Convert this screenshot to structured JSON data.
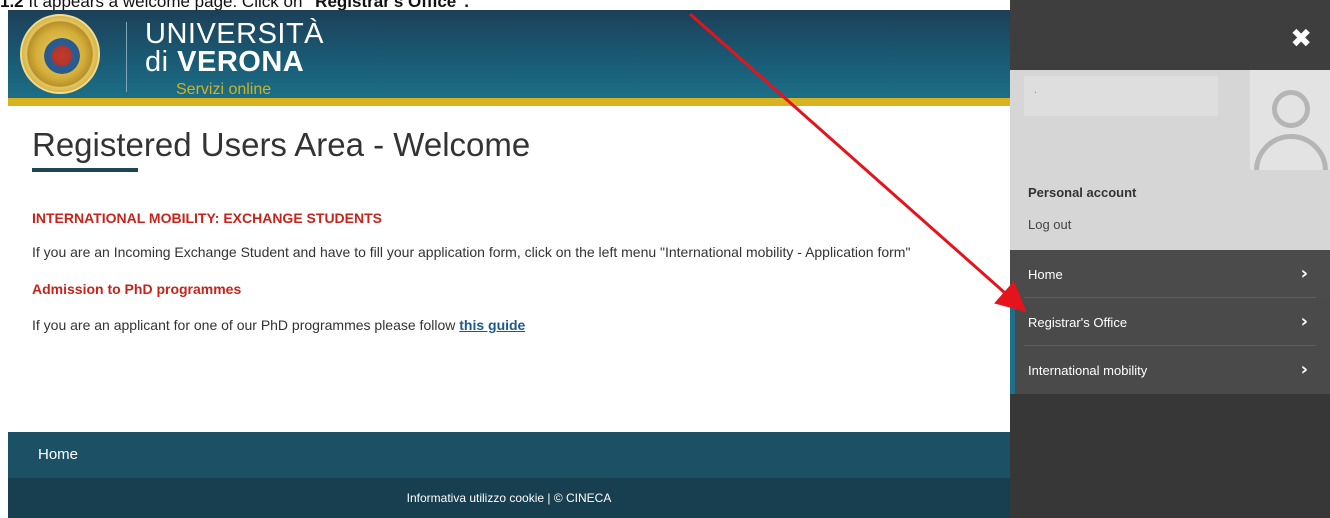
{
  "caption": {
    "prefix": "1.2 ",
    "text": "It appears a welcome page. Click on ",
    "bold": "\"Registrar's Office\"."
  },
  "header": {
    "logo_line1": "UNIVERSITÀ",
    "logo_line2_prefix": "di ",
    "logo_line2_bold": "VERONA",
    "logo_sub": "Servizi online"
  },
  "main": {
    "title": "Registered Users Area - Welcome",
    "section1_heading": "INTERNATIONAL MOBILITY: EXCHANGE STUDENTS",
    "section1_text": "If you are an Incoming Exchange Student and have to fill your application form, click on the left menu \"International mobility - Application form\"",
    "section2_heading": "Admission to PhD programmes",
    "section2_text_prefix": "If you are an applicant for one of our PhD programmes please follow ",
    "section2_link": "this guide"
  },
  "footer": {
    "nav_label": "Home",
    "bottom_text": "Informativa utilizzo cookie | © CINECA"
  },
  "side": {
    "close": "✖",
    "user_name": ".",
    "personal_account": "Personal account",
    "logout": "Log out",
    "menu": [
      {
        "label": "Home",
        "chevron": "›"
      },
      {
        "label": "Registrar's Office",
        "chevron": "›"
      },
      {
        "label": "International mobility",
        "chevron": "›"
      }
    ]
  },
  "colors": {
    "accent": "#1f6e8a",
    "heading_red": "#c8231b",
    "gold": "#d9b21f",
    "annotation": "#e5131c"
  }
}
